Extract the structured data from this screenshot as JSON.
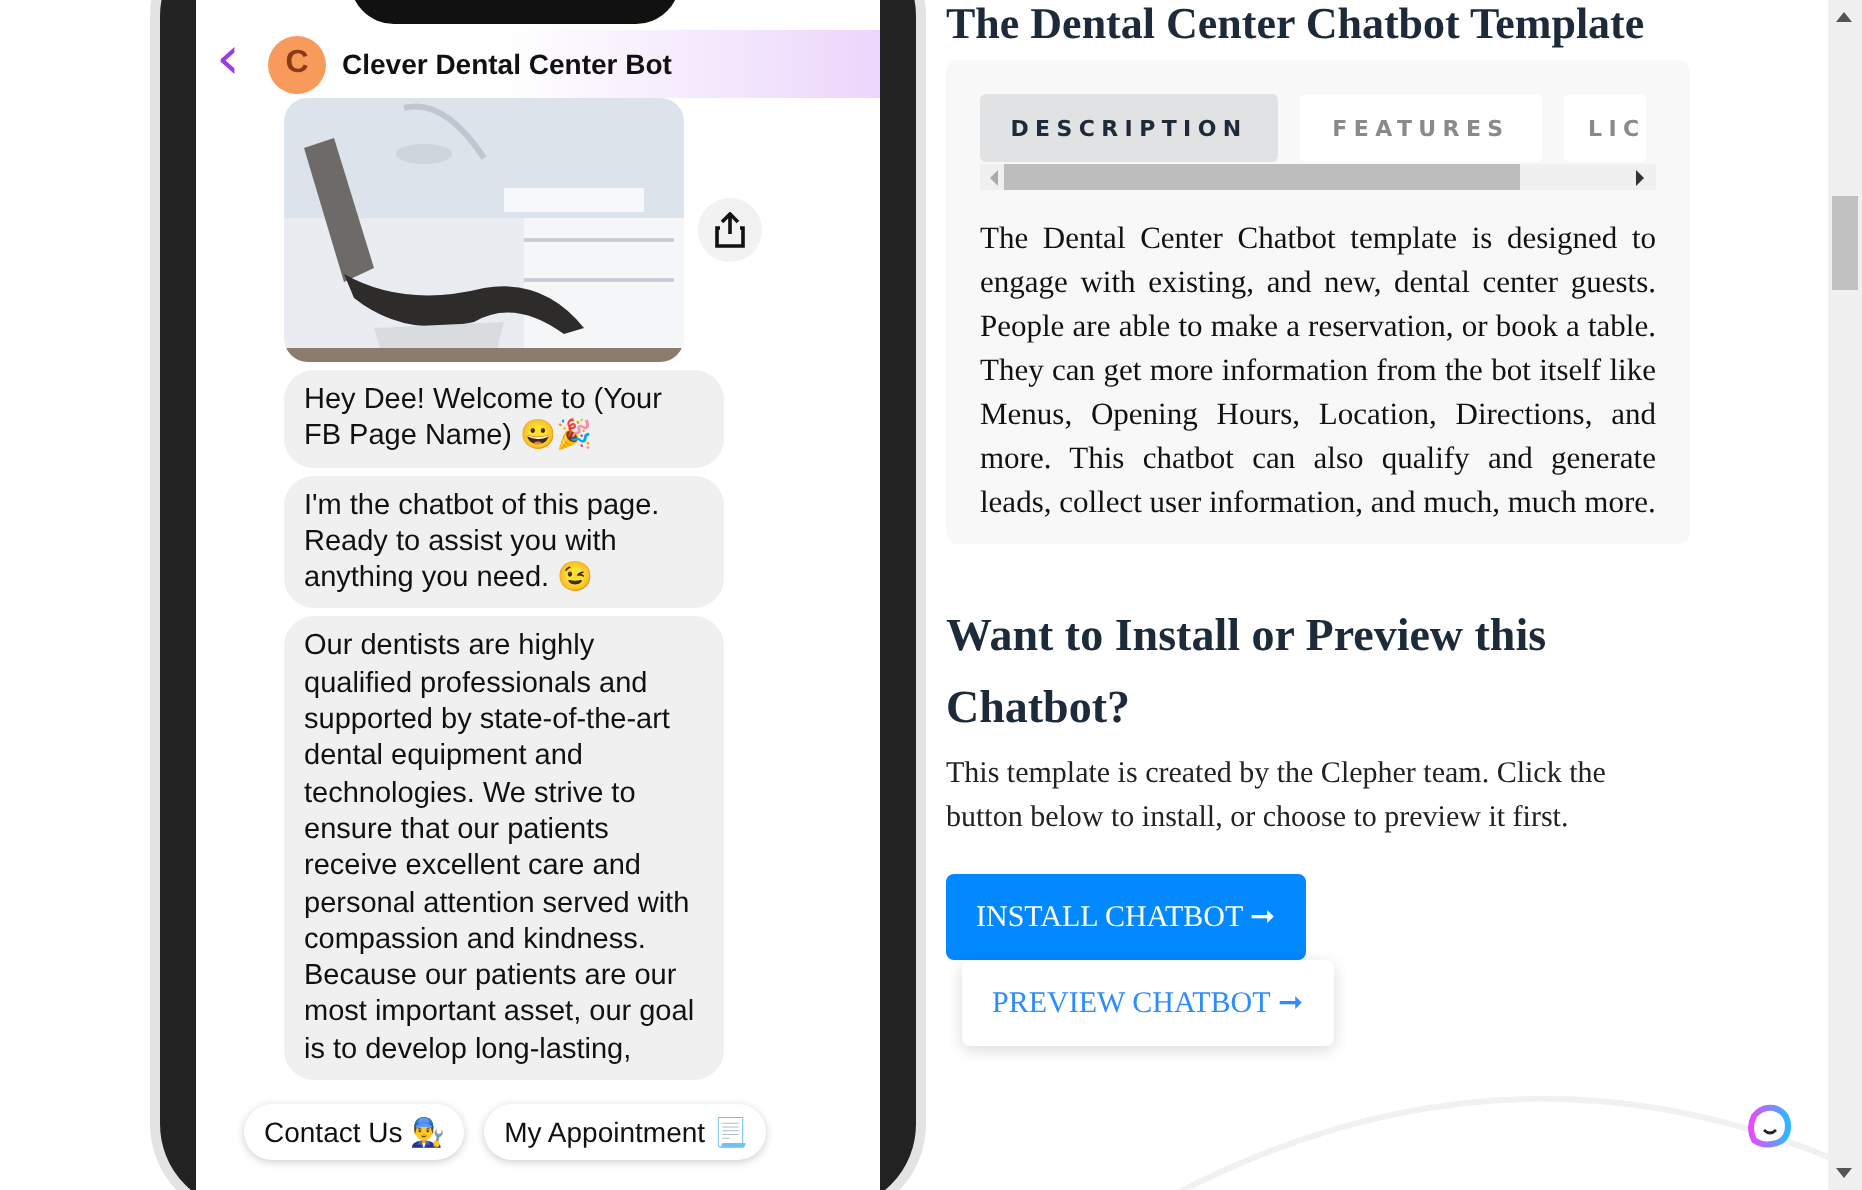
{
  "phone": {
    "chat_title": "Clever Dental Center Bot",
    "avatar_letter": "C",
    "back_glyph": "‹",
    "image": {
      "kind": "picture"
    },
    "messages": [
      "Hey Dee! Welcome to (Your FB Page Name) 😀🎉",
      "I'm the chatbot of this page. Ready to assist you with anything you need. 😉",
      "Our dentists are highly qualified professionals and supported by state-of-the-art dental equipment and technologies. We strive to ensure that our patients receive excellent care and personal attention served with compassion and kindness. Because our patients are our most important asset, our goal is to develop long-lasting,"
    ],
    "quick_replies": [
      "Contact Us 👨‍🔧",
      "My Appointment 📃"
    ]
  },
  "content": {
    "title": "The Dental Center Chatbot Template",
    "tabs": [
      {
        "label": "DESCRIPTION",
        "selected": true
      },
      {
        "label": "FEATURES",
        "selected": false
      },
      {
        "label": "LIC",
        "selected": false
      }
    ],
    "description": "The Dental Center Chatbot template is designed to engage with existing, and new, dental center guests. People are able to make a reservation, or book a table. They can get more information from the bot itself like Menus, Opening Hours, Location, Directions, and more. This chatbot can also qualify and generate leads, collect user information, and much, much more.",
    "install_heading": "Want to Install or Preview this Chatbot?",
    "install_text": "This template is created by the Clepher team. Click the button below to install, or choose to preview it first.",
    "install_button": "INSTALL CHATBOT ➞",
    "preview_button": "PREVIEW CHATBOT ➞"
  }
}
